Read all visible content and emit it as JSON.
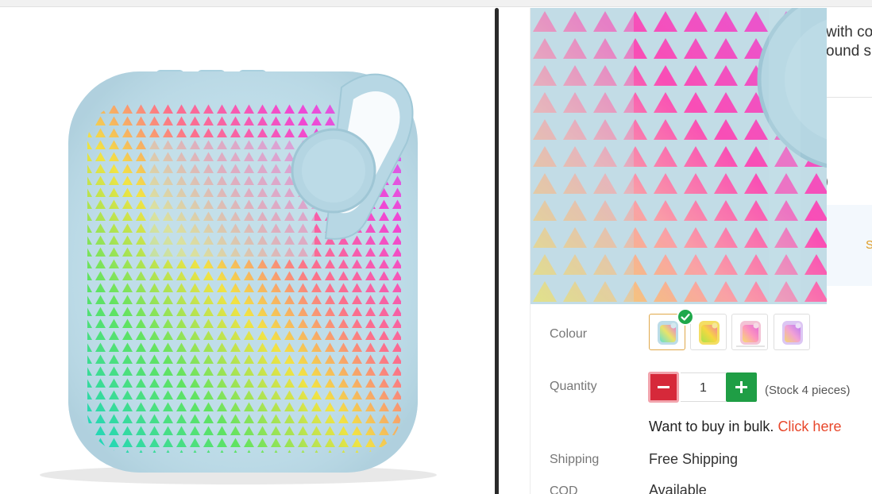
{
  "colors": {
    "accent_orange": "#e8472b",
    "minus_red": "#d6293a",
    "plus_green": "#1f9e45",
    "speaker_blue": "#bfdde9",
    "check_green": "#1fa84b"
  },
  "header": {
    "title_fragment_line1": "with col",
    "title_fragment_line2": "ound s",
    "side_fragment_1": ")",
    "promo_fragment": "S"
  },
  "options": {
    "colour_label": "Colour",
    "swatches": [
      {
        "icon": "speaker-blue-thumbnail",
        "selected": true
      },
      {
        "icon": "speaker-yellow-thumbnail",
        "selected": false
      },
      {
        "icon": "speaker-pink-thumbnail",
        "selected": false
      },
      {
        "icon": "speaker-purple-thumbnail",
        "selected": false
      }
    ],
    "quantity_label": "Quantity",
    "quantity_value": "1",
    "minus_icon": "minus-icon",
    "plus_icon": "plus-icon",
    "stock_text": "(Stock 4 pieces)",
    "bulk_text": "Want to buy in bulk.",
    "bulk_link": "Click here",
    "shipping_label": "Shipping",
    "shipping_value": "Free Shipping",
    "cod_label": "COD",
    "cod_value": "Available"
  }
}
